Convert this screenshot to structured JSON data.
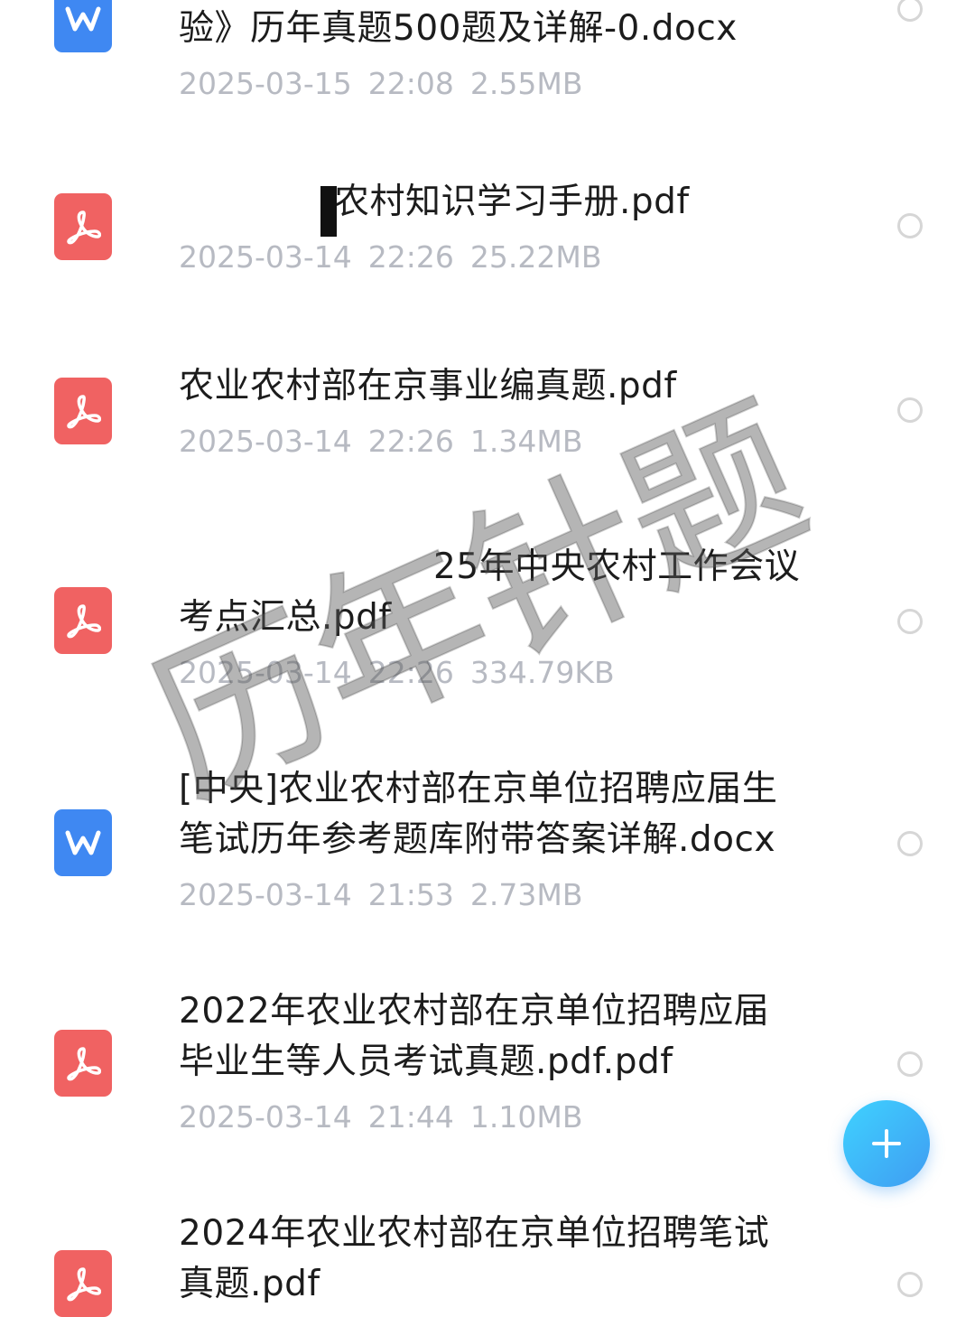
{
  "files": [
    {
      "type": "doc",
      "icon": "word-doc-icon",
      "title_lines": [
        "验》历年真题500题及详解-0.docx"
      ],
      "date": "2025-03-15",
      "time": "22:08",
      "size": "2.55MB"
    },
    {
      "type": "pdf",
      "icon": "pdf-icon",
      "title_lines": [
        "农村知识学习手册.pdf"
      ],
      "date": "2025-03-14",
      "time": "22:26",
      "size": "25.22MB"
    },
    {
      "type": "pdf",
      "icon": "pdf-icon",
      "title_lines": [
        "农业农村部在京事业编真题.pdf"
      ],
      "date": "2025-03-14",
      "time": "22:26",
      "size": "1.34MB"
    },
    {
      "type": "pdf",
      "icon": "pdf-icon",
      "title_lines": [
        "25年中央农村工作会议",
        "考点汇总.pdf"
      ],
      "date": "2025-03-14",
      "time": "22:26",
      "size": "334.79KB"
    },
    {
      "type": "doc",
      "icon": "word-doc-icon",
      "title_lines": [
        "[中央]农业农村部在京单位招聘应届生",
        "笔试历年参考题库附带答案详解.docx"
      ],
      "date": "2025-03-14",
      "time": "21:53",
      "size": "2.73MB"
    },
    {
      "type": "pdf",
      "icon": "pdf-icon",
      "title_lines": [
        "2022年农业农村部在京单位招聘应届",
        "毕业生等人员考试真题.pdf.pdf"
      ],
      "date": "2025-03-14",
      "time": "21:44",
      "size": "1.10MB"
    },
    {
      "type": "pdf",
      "icon": "pdf-icon",
      "title_lines": [
        "2024年农业农村部在京单位招聘笔试",
        "真题.pdf"
      ],
      "date": "",
      "time": "",
      "size": ""
    }
  ],
  "fab": {
    "label": "+"
  },
  "watermark": "历年针题",
  "colors": {
    "pdf": "#f06262",
    "doc": "#3f88f2",
    "fab": "#3fb4f7",
    "meta_text": "#b7bac2"
  }
}
